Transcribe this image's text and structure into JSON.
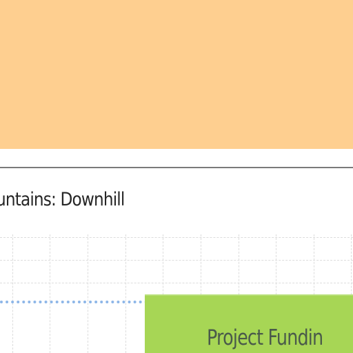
{
  "header_panel": {
    "color": "#fecf90"
  },
  "lane": {
    "title": "untains: Downhill"
  },
  "task": {
    "label": "Project Fundin",
    "color": "#a7d655"
  },
  "dependency": {
    "color": "#8db6e8"
  }
}
